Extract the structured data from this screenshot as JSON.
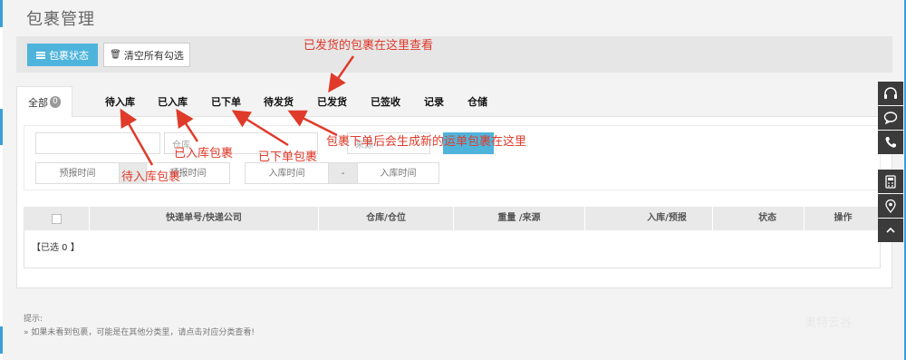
{
  "page": {
    "title": "包裹管理"
  },
  "toolbar": {
    "status_label": "包裹状态",
    "clear_label": "清空所有勾选"
  },
  "tabs": {
    "all_label": "全部",
    "all_count": "0",
    "items": [
      "待入库",
      "已入库",
      "已下单",
      "待发货",
      "已发货",
      "已签收",
      "记录",
      "仓储"
    ]
  },
  "filters": {
    "warehouse_placeholder": "仓库",
    "type_placeholder": "来源",
    "forecast_time_placeholder": "预报时间",
    "forecast_time_end_placeholder": "预报时间",
    "inbound_time_placeholder": "入库时间",
    "inbound_time_end_placeholder": "入库时间",
    "range_sep": "-"
  },
  "table": {
    "columns": [
      "快递单号/快递公司",
      "仓库/仓位",
      "重量 /来源",
      "入库/预报",
      "状态",
      "操作"
    ],
    "selected_text": "【已选 0 】"
  },
  "tips": {
    "title": "提示:",
    "line1": "» 如果未看到包裹，可能是在其他分类里，请点击对应分类查看!"
  },
  "annotations": {
    "shipped": "已发货的包裹在这里查看",
    "pending_in": "待入库包裹",
    "in_stock": "已入库包裹",
    "ordered": "已下单包裹",
    "new_waybill": "包裹下单后会生成新的运单包裹在这里",
    "annotation_color": "#e03a2a"
  },
  "colors": {
    "accent": "#4fb4dc",
    "sidebar": "#3b3b3b"
  },
  "side_tools": {
    "icons": [
      "headset-icon",
      "chat-icon",
      "phone-icon",
      "calculator-icon",
      "location-icon",
      "chevron-up-icon"
    ]
  },
  "watermark": "奥特云谷"
}
